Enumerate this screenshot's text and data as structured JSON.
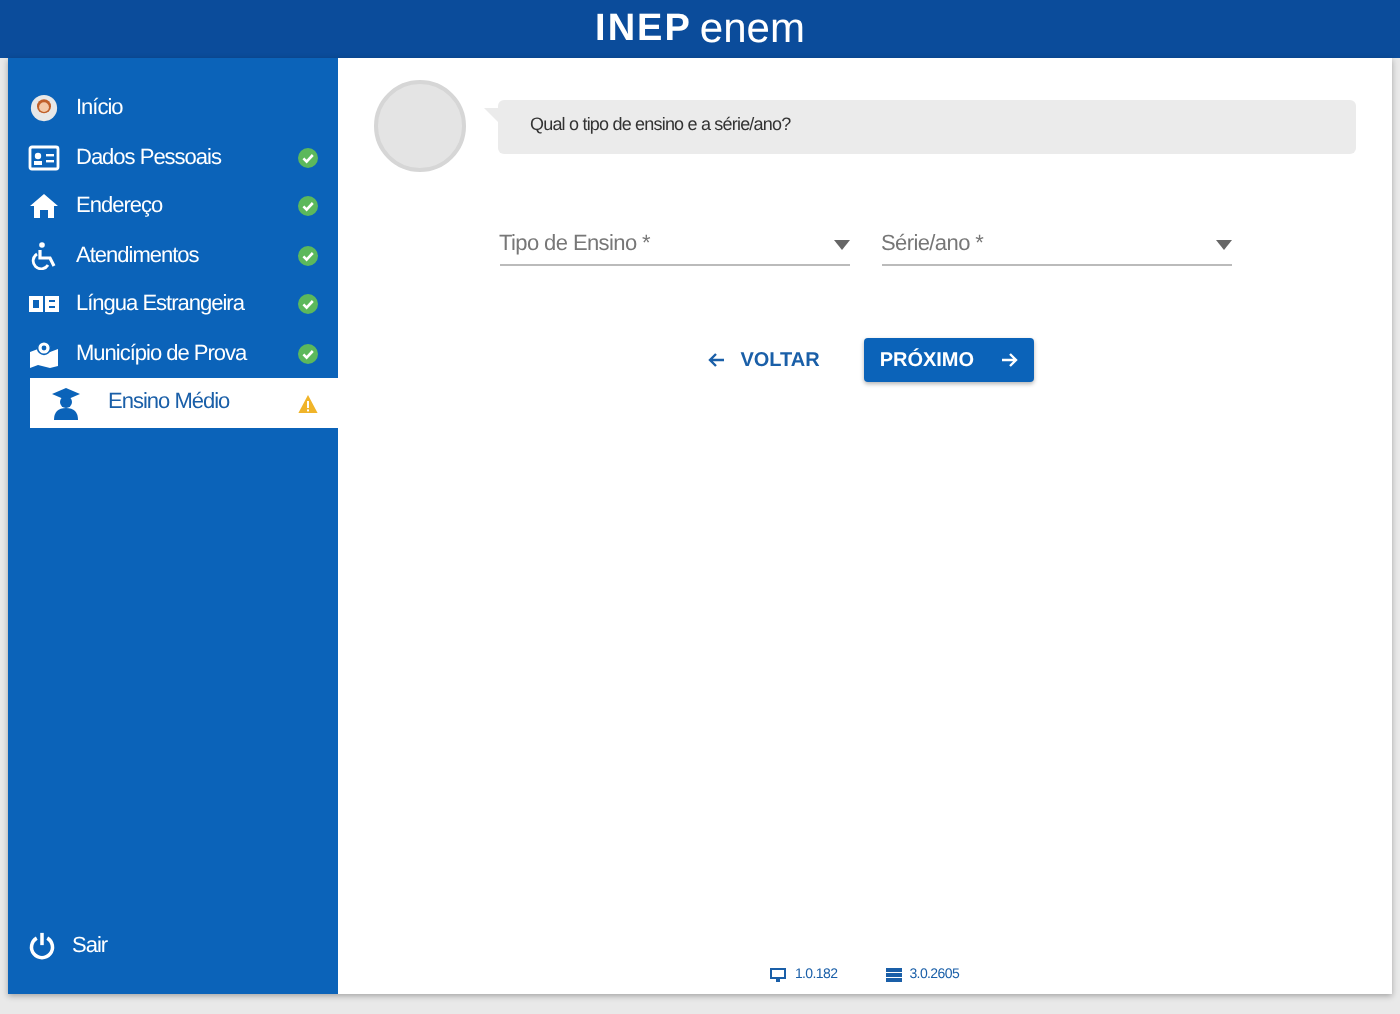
{
  "header": {
    "logo": [
      "INEP",
      "enem"
    ]
  },
  "sidebar": {
    "items": [
      {
        "label": "Início",
        "done": false,
        "warning": false,
        "selected": false
      },
      {
        "label": "Dados Pessoais",
        "done": true,
        "warning": false,
        "selected": false
      },
      {
        "label": "Endereço",
        "done": true,
        "warning": false,
        "selected": false
      },
      {
        "label": "Atendimentos",
        "done": true,
        "warning": false,
        "selected": false
      },
      {
        "label": "Língua Estrangeira",
        "done": true,
        "warning": false,
        "selected": false
      },
      {
        "label": "Município de Prova",
        "done": true,
        "warning": false,
        "selected": false
      },
      {
        "label": "Ensino Médio",
        "done": false,
        "warning": true,
        "selected": true
      }
    ],
    "logout": {
      "label": "Sair"
    }
  },
  "chat": {
    "message": "Qual o tipo de ensino e a série/ano?"
  },
  "form": {
    "fields": [
      {
        "placeholder": "Tipo de Ensino *"
      },
      {
        "placeholder": "Série/ano *"
      }
    ]
  },
  "buttons": [
    {
      "label": "VOLTAR",
      "kind": "back"
    },
    {
      "label": "PRÓXIMO",
      "kind": "next"
    }
  ],
  "footer": [
    {
      "text": "1.0.182"
    },
    {
      "text": "3.0.2605"
    }
  ]
}
